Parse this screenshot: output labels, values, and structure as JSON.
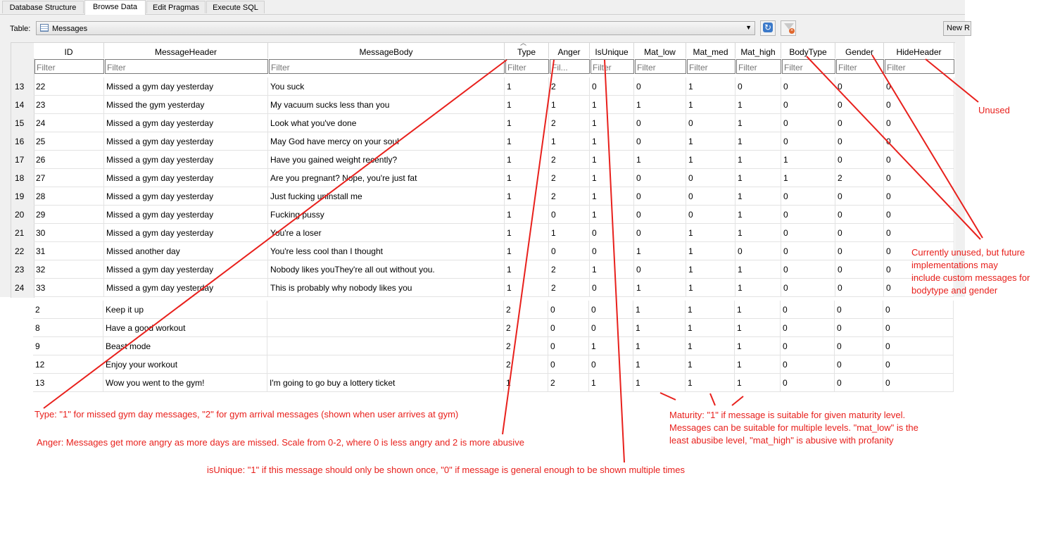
{
  "tabs": [
    "Database Structure",
    "Browse Data",
    "Edit Pragmas",
    "Execute SQL"
  ],
  "active_tab": 1,
  "toolbar": {
    "table_label": "Table:",
    "table_value": "Messages",
    "new_record_label": "New R"
  },
  "columns": [
    "ID",
    "MessageHeader",
    "MessageBody",
    "Type",
    "Anger",
    "IsUnique",
    "Mat_low",
    "Mat_med",
    "Mat_high",
    "BodyType",
    "Gender",
    "HideHeader"
  ],
  "filter_placeholders": [
    "Filter",
    "Filter",
    "Filter",
    "Filter",
    "Fil...",
    "Filter",
    "Filter",
    "Filter",
    "Filter",
    "Filter",
    "Filter",
    "Filter"
  ],
  "rows": [
    {
      "n": "13",
      "c": [
        "22",
        "Missed a gym day yesterday",
        "You suck",
        "1",
        "2",
        "0",
        "0",
        "1",
        "0",
        "0",
        "0",
        "0"
      ]
    },
    {
      "n": "14",
      "c": [
        "23",
        "Missed the gym yesterday",
        "My vacuum sucks less than you",
        "1",
        "1",
        "1",
        "1",
        "1",
        "1",
        "0",
        "0",
        "0"
      ]
    },
    {
      "n": "15",
      "c": [
        "24",
        "Missed a gym day yesterday",
        "Look what you've done",
        "1",
        "2",
        "1",
        "0",
        "0",
        "1",
        "0",
        "0",
        "0"
      ]
    },
    {
      "n": "16",
      "c": [
        "25",
        "Missed a gym day yesterday",
        "May God have mercy on your soul",
        "1",
        "1",
        "1",
        "0",
        "1",
        "1",
        "0",
        "0",
        "0"
      ]
    },
    {
      "n": "17",
      "c": [
        "26",
        "Missed a gym day yesterday",
        "Have you gained weight recently?",
        "1",
        "2",
        "1",
        "1",
        "1",
        "1",
        "1",
        "0",
        "0"
      ]
    },
    {
      "n": "18",
      "c": [
        "27",
        "Missed a gym day yesterday",
        "Are you pregnant? Nope, you're just fat",
        "1",
        "2",
        "1",
        "0",
        "0",
        "1",
        "1",
        "2",
        "0"
      ]
    },
    {
      "n": "19",
      "c": [
        "28",
        "Missed a gym day yesterday",
        "Just fucking uninstall me",
        "1",
        "2",
        "1",
        "0",
        "0",
        "1",
        "0",
        "0",
        "0"
      ]
    },
    {
      "n": "20",
      "c": [
        "29",
        "Missed a gym day yesterday",
        "Fucking pussy",
        "1",
        "0",
        "1",
        "0",
        "0",
        "1",
        "0",
        "0",
        "0"
      ]
    },
    {
      "n": "21",
      "c": [
        "30",
        "Missed a gym day yesterday",
        "You're a loser",
        "1",
        "1",
        "0",
        "0",
        "1",
        "1",
        "0",
        "0",
        "0"
      ]
    },
    {
      "n": "22",
      "c": [
        "31",
        "Missed another day",
        "You're less cool than I thought",
        "1",
        "0",
        "0",
        "1",
        "1",
        "0",
        "0",
        "0",
        "0"
      ]
    },
    {
      "n": "23",
      "c": [
        "32",
        "Missed a gym day yesterday",
        "Nobody likes youThey're all out without you.",
        "1",
        "2",
        "1",
        "0",
        "1",
        "1",
        "0",
        "0",
        "0"
      ]
    },
    {
      "n": "24",
      "c": [
        "33",
        "Missed a gym day yesterday",
        "This is probably why nobody likes you",
        "1",
        "2",
        "0",
        "1",
        "1",
        "1",
        "0",
        "0",
        "0"
      ]
    }
  ],
  "lower_rows": [
    {
      "c": [
        "2",
        "Keep it up",
        "",
        "2",
        "0",
        "0",
        "1",
        "1",
        "1",
        "0",
        "0",
        "0"
      ]
    },
    {
      "c": [
        "8",
        "Have a good workout",
        "",
        "2",
        "0",
        "0",
        "1",
        "1",
        "1",
        "0",
        "0",
        "0"
      ]
    },
    {
      "c": [
        "9",
        "Beast mode",
        "",
        "2",
        "0",
        "1",
        "1",
        "1",
        "1",
        "0",
        "0",
        "0"
      ]
    },
    {
      "c": [
        "12",
        "Enjoy your workout",
        "",
        "2",
        "0",
        "0",
        "1",
        "1",
        "1",
        "0",
        "0",
        "0"
      ]
    },
    {
      "c": [
        "13",
        "Wow you went to the gym!",
        "I'm going to go buy a lottery ticket",
        "1",
        "2",
        "1",
        "1",
        "1",
        "1",
        "0",
        "0",
        "0"
      ]
    }
  ],
  "annotations": {
    "unused": "Unused",
    "bodytype_gender": [
      "Currently unused, but future",
      "implementations may",
      "include custom messages for",
      "bodytype and gender"
    ],
    "type": "Type: \"1\" for missed gym day messages, \"2\" for gym arrival messages (shown when user arrives at gym)",
    "anger": "Anger: Messages get more angry as more days are missed. Scale from 0-2, where 0 is less angry and 2 is more abusive",
    "isunique": "isUnique: \"1\" if this message should only be shown once, \"0\" if message is general enough to be shown multiple times",
    "maturity": [
      "Maturity: \"1\" if message is suitable for given maturity level.",
      "Messages can be suitable for multiple levels. \"mat_low\" is the",
      "least abusibe level, \"mat_high\" is abusive with profanity"
    ]
  },
  "colors": {
    "annotation": "#e8201c",
    "window_bg": "#f0f0f0",
    "grid_line": "#e3e3e3"
  }
}
